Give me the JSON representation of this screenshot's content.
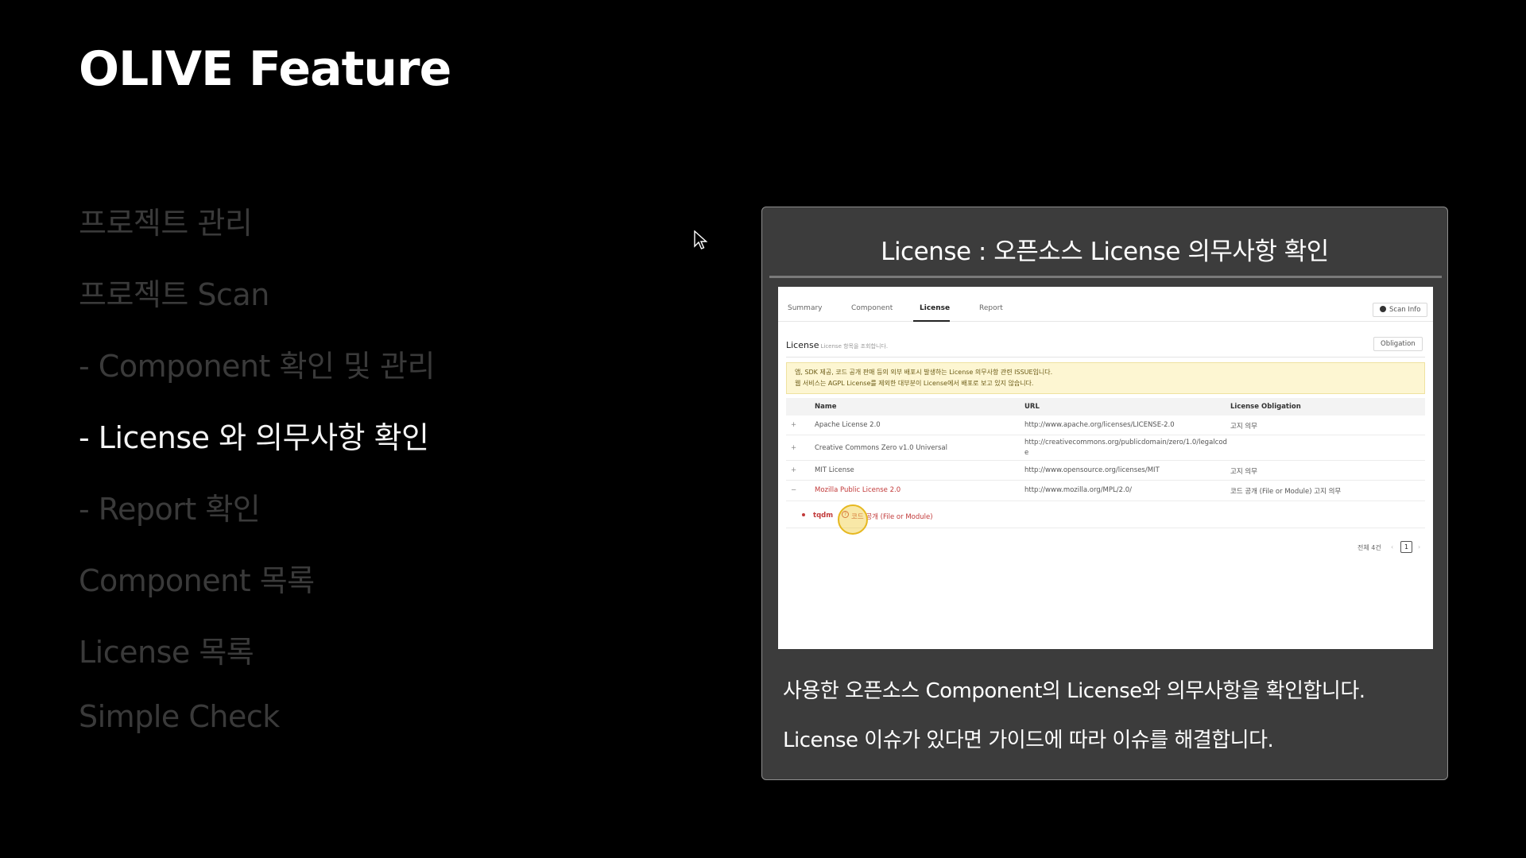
{
  "slide_title": "OLIVE  Feature",
  "menu": [
    {
      "label": "프로젝트 관리",
      "active": false
    },
    {
      "label": "프로젝트 Scan",
      "active": false
    },
    {
      "label": "- Component 확인 및 관리",
      "active": false
    },
    {
      "label": "- License 와 의무사항 확인",
      "active": true
    },
    {
      "label": "- Report 확인",
      "active": false
    },
    {
      "label": "Component 목록",
      "active": false
    },
    {
      "label": "License 목록",
      "active": false
    },
    {
      "label": "Simple Check",
      "active": false
    }
  ],
  "panel": {
    "title": "License : 오픈소스 License 의무사항 확인",
    "captions": [
      "사용한 오픈소스 Component의 License와 의무사항을 확인합니다.",
      "License 이슈가 있다면 가이드에 따라 이슈를 해결합니다."
    ]
  },
  "app": {
    "tabs": [
      "Summary",
      "Component",
      "License",
      "Report"
    ],
    "selected_tab": "License",
    "scan_info_label": "Scan Info",
    "license_heading": "License",
    "license_subheading": "License 항목을 조회합니다.",
    "obligation_button": "Obligation",
    "notice_lines": [
      "앱, SDK 제공, 코드 공개 판매 등의 외부 배포시 발생하는 License 의무사항 관련 ISSUE입니다.",
      "웹 서비스는 AGPL License를 제외한 대부분이 License에서 배포로 보고 있지 않습니다."
    ],
    "table_headers": {
      "name": "Name",
      "url": "URL",
      "obligation": "License Obligation"
    },
    "rows": [
      {
        "toggle": "+",
        "name": "Apache License 2.0",
        "url": "http://www.apache.org/licenses/LICENSE-2.0",
        "obligation": "고지 의무"
      },
      {
        "toggle": "+",
        "name": "Creative Commons Zero v1.0 Universal",
        "url": "http://creativecommons.org/publicdomain/zero/1.0/legalcode",
        "obligation": ""
      },
      {
        "toggle": "+",
        "name": "MIT License",
        "url": "http://www.opensource.org/licenses/MIT",
        "obligation": "고지 의무"
      },
      {
        "toggle": "−",
        "name": "Mozilla Public License 2.0",
        "url": "http://www.mozilla.org/MPL/2.0/",
        "obligation": "코드 공개 (File or Module) 고지 의무"
      }
    ],
    "sub_row": {
      "component": "tqdm",
      "hint": "?",
      "desc": "코드 공개 (File or Module)"
    },
    "pagination": {
      "total": "전체 4건",
      "prev": "‹",
      "current": "1",
      "next": "›"
    },
    "accent_colors": {
      "warning_bg": "#fdf6d2",
      "issue_red": "#c23a3a",
      "highlight": "#e6b820"
    }
  }
}
